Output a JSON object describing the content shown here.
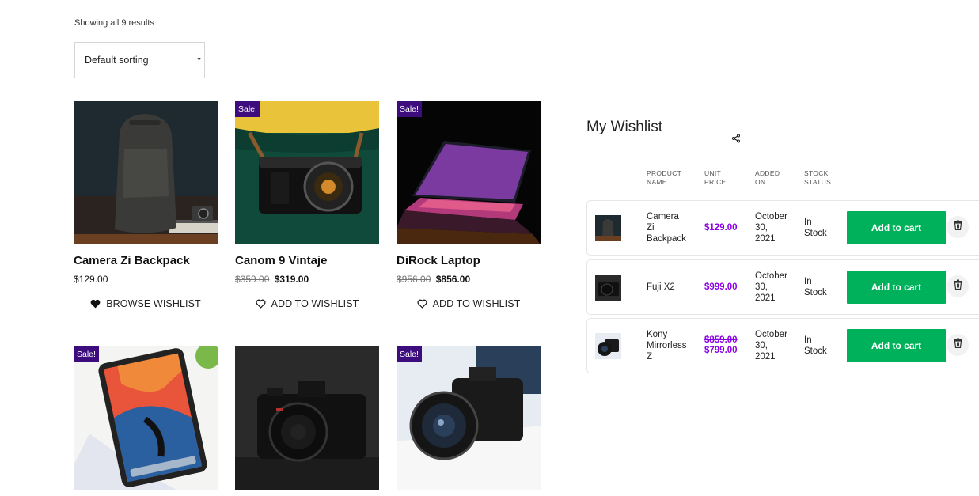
{
  "shop": {
    "results_text": "Showing all 9 results",
    "sort_value": "Default sorting"
  },
  "products": [
    {
      "title": "Camera Zi Backpack",
      "price": "$129.00",
      "sale": false,
      "wishlist_label": "BROWSE WISHLIST",
      "wishlist_icon": "heart-filled-icon"
    },
    {
      "title": "Canom 9 Vintaje",
      "old_price": "$359.00",
      "price": "$319.00",
      "sale": true,
      "sale_label": "Sale!",
      "wishlist_label": "ADD TO WISHLIST",
      "wishlist_icon": "heart-outline-icon"
    },
    {
      "title": "DiRock Laptop",
      "old_price": "$956.00",
      "price": "$856.00",
      "sale": true,
      "sale_label": "Sale!",
      "wishlist_label": "ADD TO WISHLIST",
      "wishlist_icon": "heart-outline-icon"
    },
    {
      "sale": true,
      "sale_label": "Sale!"
    },
    {
      "sale": false
    },
    {
      "sale": true,
      "sale_label": "Sale!"
    }
  ],
  "wishlist": {
    "title": "My Wishlist",
    "share_icon": "share-icon",
    "headers": {
      "product_name": [
        "PRODUCT",
        "NAME"
      ],
      "unit_price": [
        "UNIT",
        "PRICE"
      ],
      "added_on": [
        "ADDED",
        "ON"
      ],
      "stock_status": [
        "STOCK",
        "STATUS"
      ]
    },
    "rows": [
      {
        "name": [
          "Camera",
          "Zi",
          "Backpack"
        ],
        "price": "$129.00",
        "date": [
          "October",
          "30,",
          "2021"
        ],
        "stock": [
          "In",
          "Stock"
        ],
        "button": "Add to cart"
      },
      {
        "name": [
          "Fuji X2"
        ],
        "price": "$999.00",
        "date": [
          "October",
          "30,",
          "2021"
        ],
        "stock": [
          "In",
          "Stock"
        ],
        "button": "Add to cart"
      },
      {
        "name": [
          "Kony",
          "Mirrorless",
          "Z"
        ],
        "old_price": "$859.00",
        "price": "$799.00",
        "date": [
          "October",
          "30,",
          "2021"
        ],
        "stock": [
          "In",
          "Stock"
        ],
        "button": "Add to cart"
      }
    ]
  },
  "colors": {
    "sale_badge": "#3d0d7e",
    "price_accent": "#8a00e6",
    "cart_button": "#00b15b"
  }
}
